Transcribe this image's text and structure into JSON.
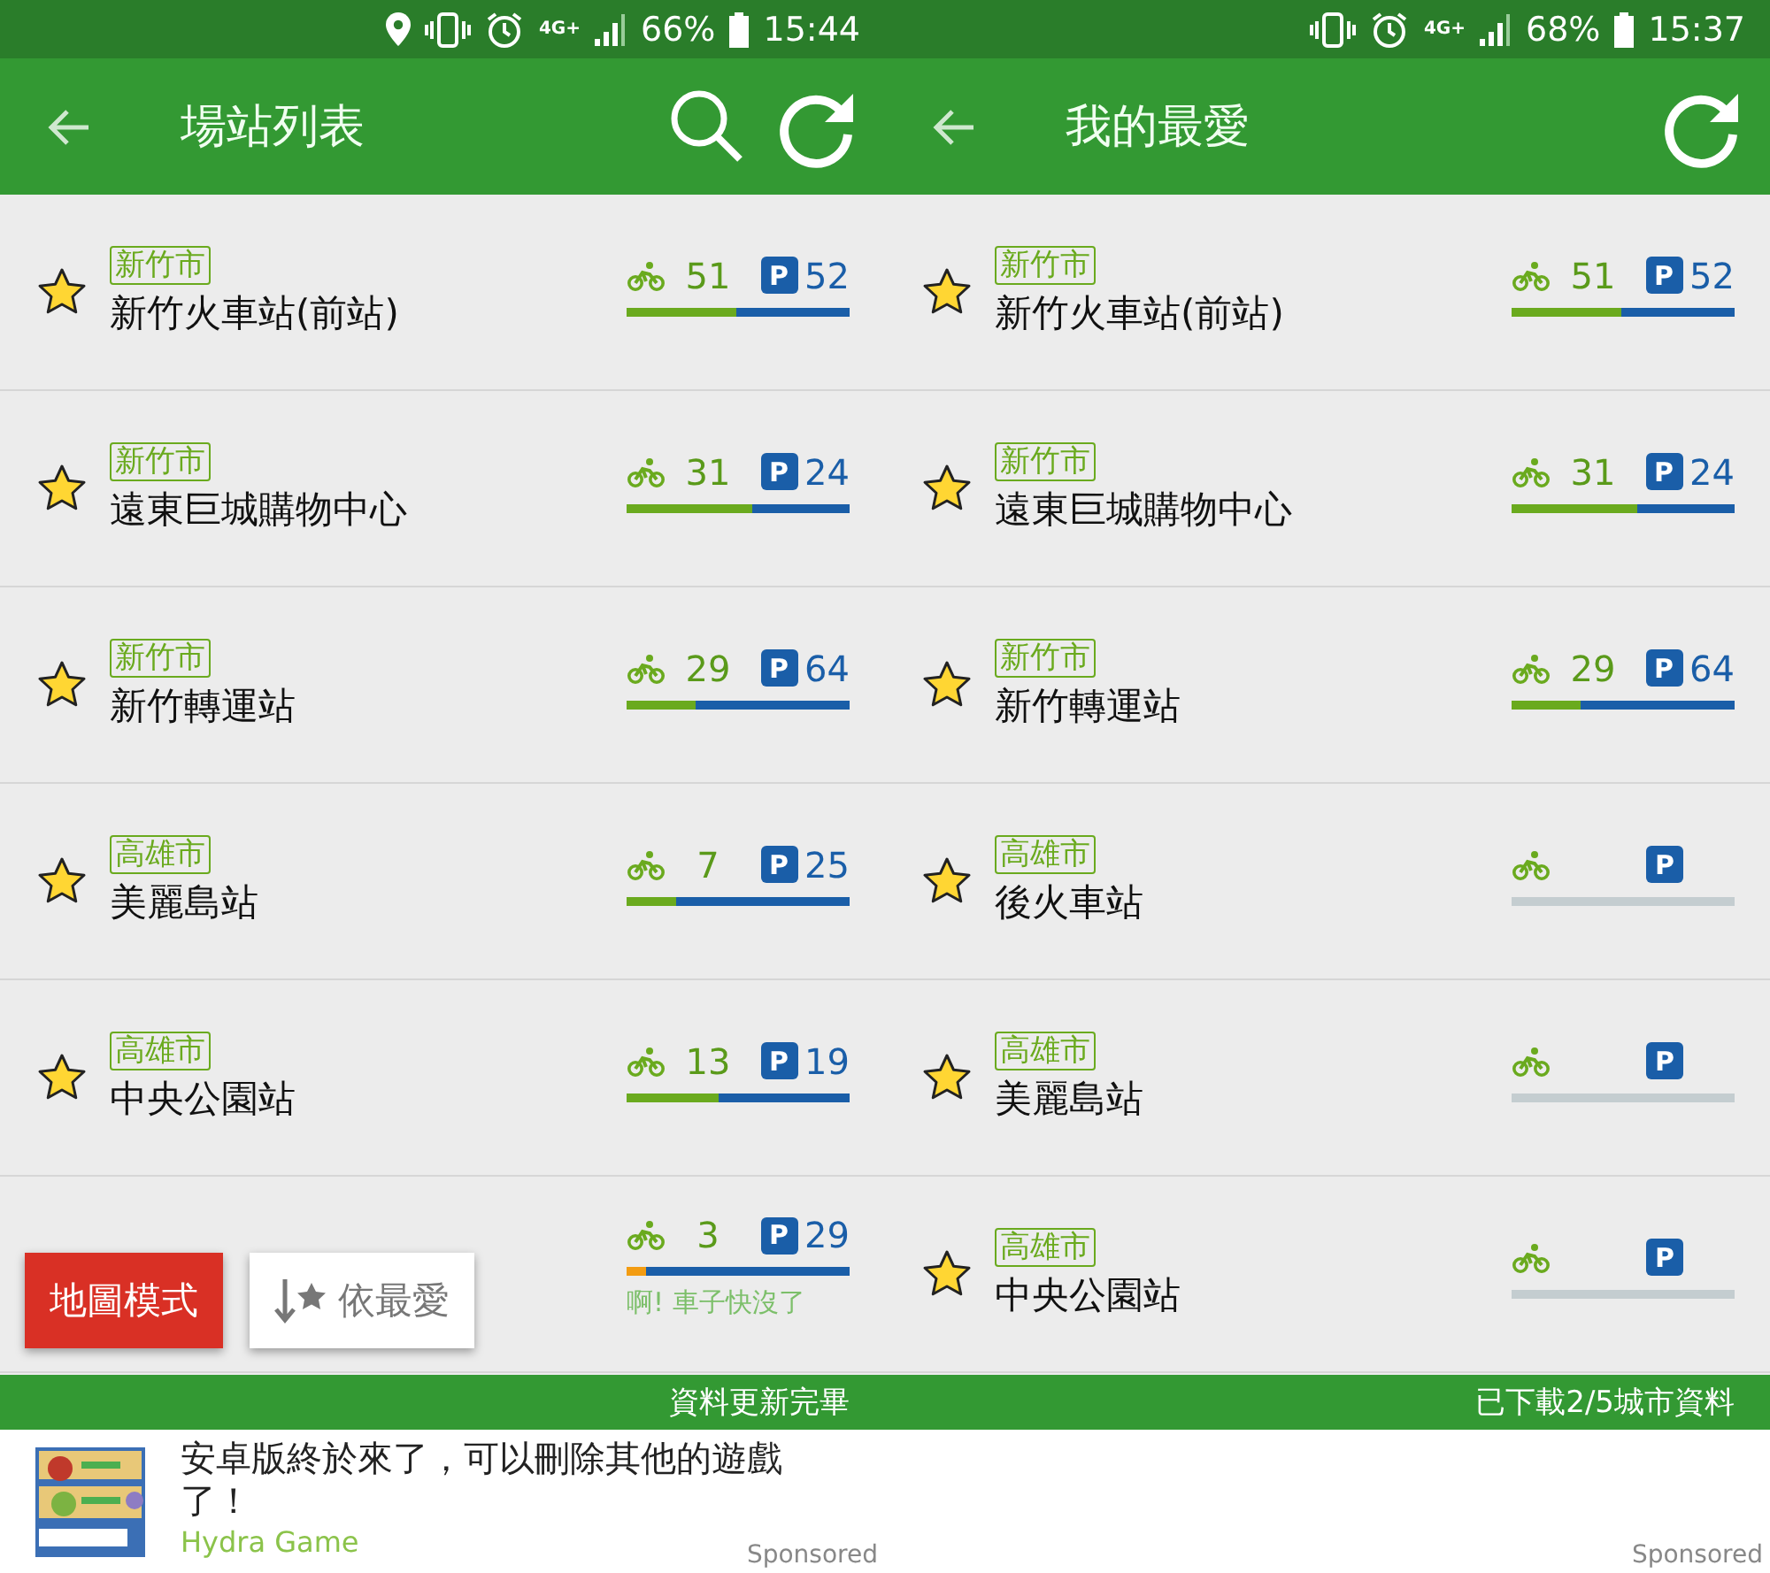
{
  "panels": [
    {
      "status": {
        "location": true,
        "network": "4G+",
        "battery": "66%",
        "time": "15:44"
      },
      "toolbar": {
        "title": "場站列表",
        "search": true
      },
      "stations": [
        {
          "kind": "normal",
          "city": "新竹市",
          "name": "新竹火車站(前站)",
          "bikes": "51",
          "parking_badge": "P",
          "parking": "52",
          "level": 0.495
        },
        {
          "kind": "normal",
          "city": "新竹市",
          "name": "遠東巨城購物中心",
          "bikes": "31",
          "parking_badge": "P",
          "parking": "24",
          "level": 0.56
        },
        {
          "kind": "normal",
          "city": "新竹市",
          "name": "新竹轉運站",
          "bikes": "29",
          "parking_badge": "P",
          "parking": "64",
          "level": 0.31
        },
        {
          "kind": "normal",
          "city": "高雄市",
          "name": "美麗島站",
          "bikes": "7",
          "parking_badge": "P",
          "parking": "25",
          "level": 0.22
        },
        {
          "kind": "normal",
          "city": "高雄市",
          "name": "中央公園站",
          "bikes": "13",
          "parking_badge": "P",
          "parking": "19",
          "level": 0.41
        },
        {
          "kind": "low",
          "bikes": "3",
          "parking_badge": "P",
          "parking": "29",
          "level": 0.09,
          "alert": "啊! 車子快沒了"
        }
      ],
      "buttons": [
        {
          "kind": "primary",
          "label": "地圖模式"
        },
        {
          "kind": "sort",
          "label": "依最愛"
        }
      ],
      "message": "資料更新完畢",
      "ad": {
        "kind": "picture",
        "text": "安卓版終於來了，可以刪除其他的遊戲了！",
        "advertiser": "Hydra Game",
        "sponsored": "Sponsored"
      }
    },
    {
      "status": {
        "location": false,
        "network": "4G+",
        "battery": "68%",
        "time": "15:37"
      },
      "toolbar": {
        "title": "我的最愛",
        "search": false
      },
      "stations": [
        {
          "kind": "normal",
          "city": "新竹市",
          "name": "新竹火車站(前站)",
          "bikes": "51",
          "parking_badge": "P",
          "parking": "52",
          "level": 0.495
        },
        {
          "kind": "normal",
          "city": "新竹市",
          "name": "遠東巨城購物中心",
          "bikes": "31",
          "parking_badge": "P",
          "parking": "24",
          "level": 0.56
        },
        {
          "kind": "normal",
          "city": "新竹市",
          "name": "新竹轉運站",
          "bikes": "29",
          "parking_badge": "P",
          "parking": "64",
          "level": 0.31
        },
        {
          "kind": "empty",
          "city": "高雄市",
          "name": "後火車站",
          "parking_badge": "P"
        },
        {
          "kind": "empty",
          "city": "高雄市",
          "name": "美麗島站",
          "parking_badge": "P"
        },
        {
          "kind": "empty",
          "city": "高雄市",
          "name": "中央公園站",
          "parking_badge": "P"
        }
      ],
      "message": "已下載2/5城市資料",
      "ad": {
        "sponsored": "Sponsored"
      }
    }
  ]
}
